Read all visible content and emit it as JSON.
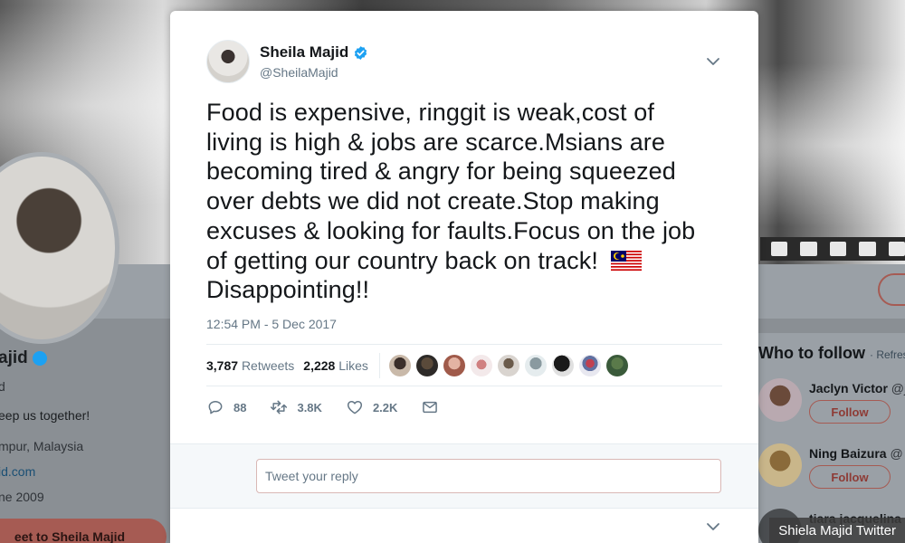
{
  "background": {
    "profile": {
      "name": "ajid",
      "handle": "d",
      "bio": "eep us together!",
      "location": "mpur, Malaysia",
      "url": "id.com",
      "joined": "ne 2009",
      "tweet_button": "eet to Sheila Majid"
    },
    "who_to_follow": {
      "title": "Who to follow",
      "refresh": "· Refres",
      "users": [
        {
          "name": "Jaclyn Victor",
          "handle": "@j",
          "button": "Follow"
        },
        {
          "name": "Ning Baizura",
          "handle": "@",
          "button": "Follow"
        },
        {
          "name": "tiara jacquelina",
          "handle": "",
          "button": ""
        }
      ]
    }
  },
  "tweet": {
    "author": {
      "name": "Sheila Majid",
      "handle": "@SheilaMajid",
      "verified": true
    },
    "text": "Food is expensive, ringgit is weak,cost of living is high & jobs are scarce.Msians are becoming tired & angry for being squeezed over debts we did not create.Stop making excuses & looking for faults.Focus on the job of getting our country back on track!",
    "text_tail": "Disappointing!!",
    "emoji": "malaysia-flag",
    "timestamp": "12:54 PM - 5 Dec 2017",
    "stats": {
      "retweets_count": "3,787",
      "retweets_label": "Retweets",
      "likes_count": "2,228",
      "likes_label": "Likes"
    },
    "likers": 9,
    "actions": {
      "replies": "88",
      "retweets": "3.8K",
      "likes": "2.2K"
    }
  },
  "reply": {
    "placeholder": "Tweet your reply"
  },
  "watermark": "Shiela Majid Twitter",
  "colors": {
    "brand_blue": "#1da1f2",
    "muted": "#657786",
    "text": "#14171a"
  }
}
